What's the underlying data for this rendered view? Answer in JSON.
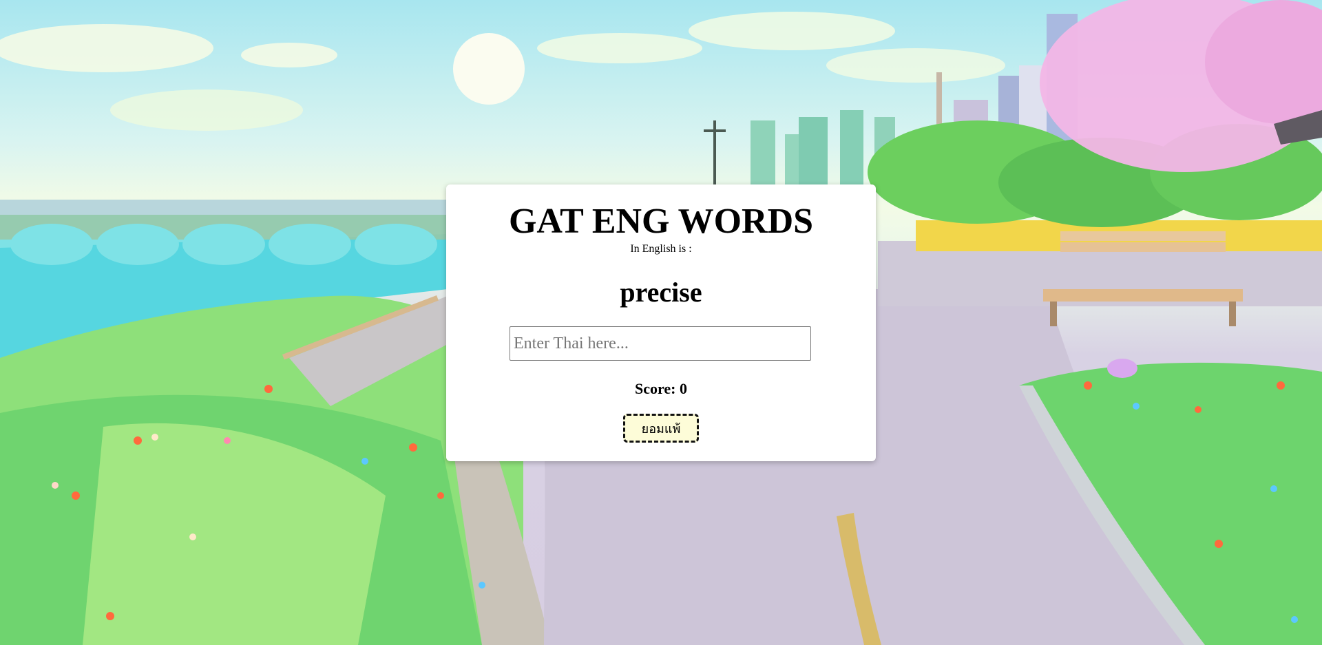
{
  "app": {
    "title": "GAT ENG WORDS",
    "prompt_label": "In English is :",
    "current_word": "precise"
  },
  "answer_input": {
    "value": "",
    "placeholder": "Enter Thai here..."
  },
  "score": {
    "text": "Score: 0"
  },
  "buttons": {
    "give_up_label": "ยอมแพ้"
  },
  "colors": {
    "card_background": "#ffffff",
    "give_up_button_background": "#fdfcd8"
  }
}
